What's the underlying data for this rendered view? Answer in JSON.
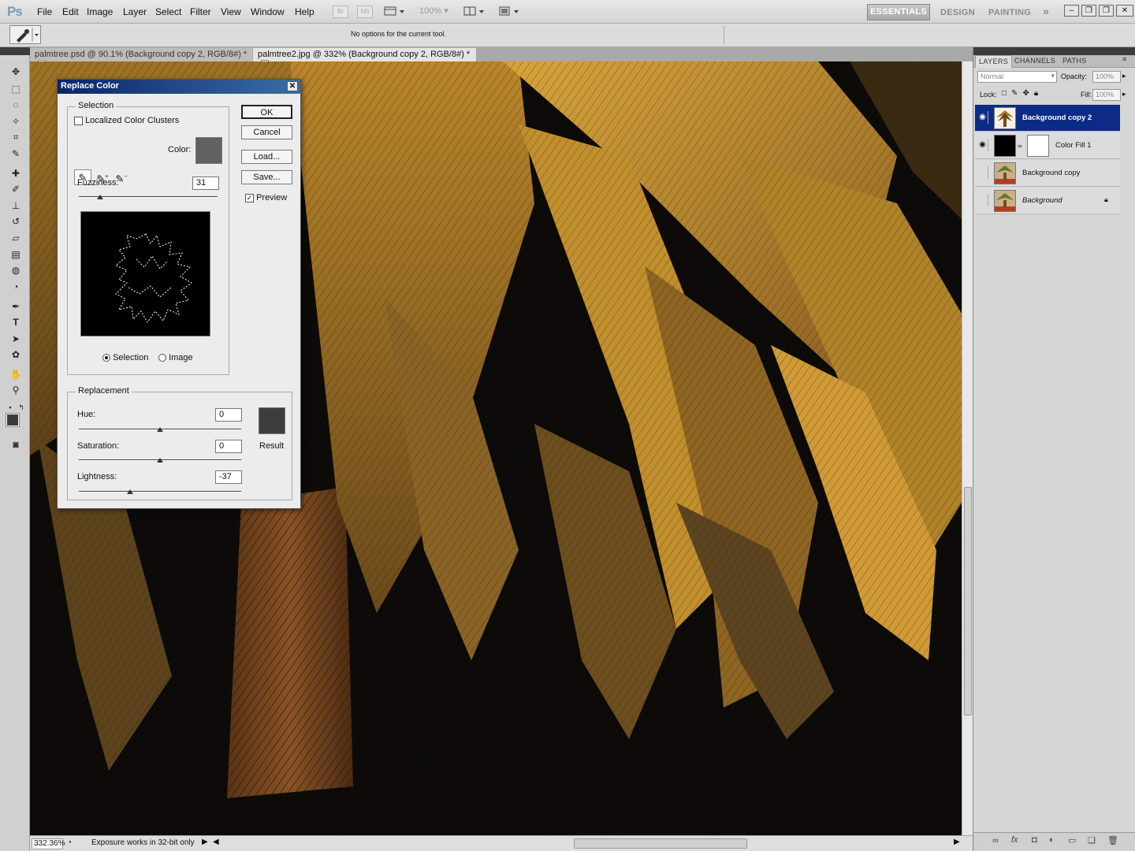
{
  "app": {
    "logo": "Ps",
    "menu": [
      "File",
      "Edit",
      "Image",
      "Layer",
      "Select",
      "Filter",
      "View",
      "Window",
      "Help"
    ],
    "bridge_btn": "Br",
    "minibridge_btn": "Mb",
    "zoom_select": "100%",
    "workspaces": {
      "active": "ESSENTIALS",
      "design": "DESIGN",
      "painting": "PAINTING",
      "more": "»"
    }
  },
  "options_bar": {
    "message": "No options for the current tool."
  },
  "tabs": [
    {
      "label": "palmtree.psd @ 90.1% (Background copy 2, RGB/8#) *",
      "close": "x"
    },
    {
      "label": "palmtree2.jpg @ 332% (Background copy 2, RGB/8#) *",
      "close": "x"
    }
  ],
  "status": {
    "zoom": "332.36%",
    "message": "Exposure works in 32-bit only"
  },
  "panels": {
    "tabs": [
      "LAYERS",
      "CHANNELS",
      "PATHS"
    ],
    "blend_mode": "Normal",
    "opacity_label": "Opacity:",
    "opacity_value": "100%",
    "lock_label": "Lock:",
    "fill_label": "Fill:",
    "fill_value": "100%",
    "layers": [
      {
        "name": "Background copy 2",
        "visible": true,
        "selected": true
      },
      {
        "name": "Color Fill 1",
        "visible": true,
        "selected": false
      },
      {
        "name": "Background copy",
        "visible": false,
        "selected": false
      },
      {
        "name": "Background",
        "visible": false,
        "selected": false
      }
    ]
  },
  "dialog": {
    "title": "Replace Color",
    "close": "✕",
    "selection": {
      "title": "Selection",
      "localized_label": "Localized Color Clusters",
      "localized_checked": false,
      "color_label": "Color:",
      "color": "#5f625f",
      "fuzziness_label": "Fuzziness:",
      "fuzziness": "31",
      "fuzziness_fraction": 0.155,
      "radio_selection": "Selection",
      "radio_image": "Image",
      "mode": "selection"
    },
    "buttons": {
      "ok": "OK",
      "cancel": "Cancel",
      "load": "Load...",
      "save": "Save..."
    },
    "preview_label": "Preview",
    "preview_checked": true,
    "replacement": {
      "title": "Replacement",
      "hue_label": "Hue:",
      "hue": "0",
      "hue_fraction": 0.5,
      "saturation_label": "Saturation:",
      "saturation": "0",
      "saturation_fraction": 0.5,
      "lightness_label": "Lightness:",
      "lightness": "-37",
      "lightness_fraction": 0.315,
      "result_label": "Result",
      "result_color": "#3d3d3d"
    }
  }
}
